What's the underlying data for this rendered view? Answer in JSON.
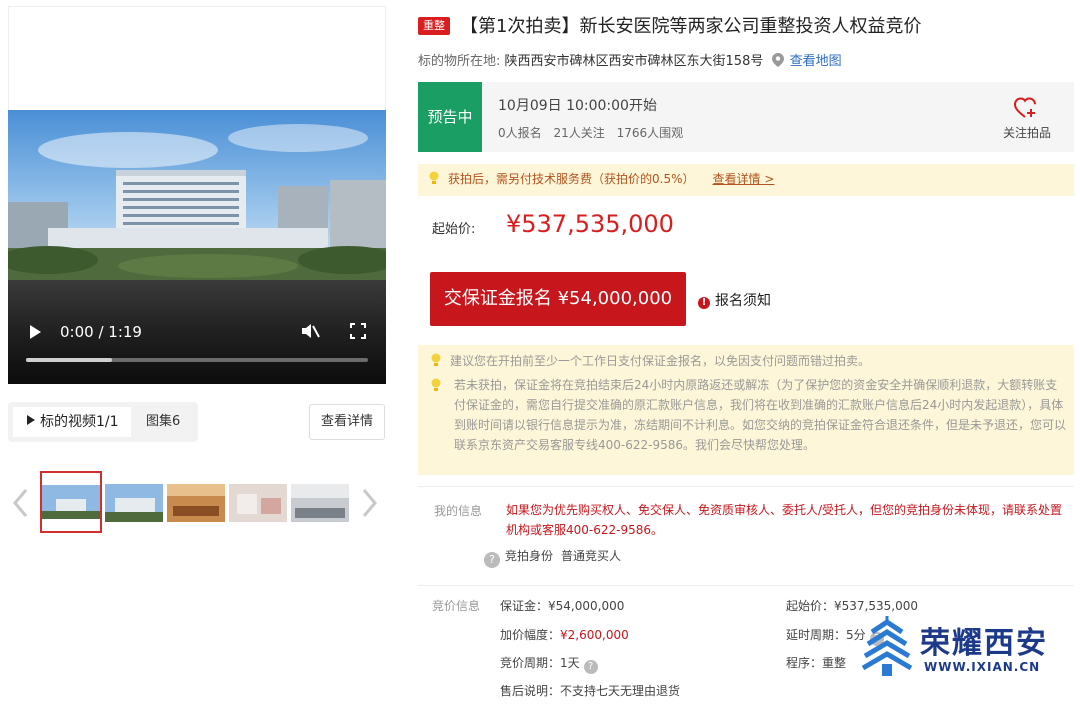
{
  "media": {
    "time_display": "0:00 / 1:19",
    "progress": 0.25,
    "tab_video_label": "标的视频1/1",
    "tab_gallery_label": "图集6",
    "detail_button": "查看详情"
  },
  "thumbnails": [
    "hospital-aerial",
    "hospital-front",
    "interior-hall",
    "ward-room",
    "lobby-seating"
  ],
  "auction": {
    "badge": "重整",
    "title": "【第1次拍卖】新长安医院等两家公司重整投资人权益竞价",
    "location_label": "标的物所在地:",
    "location_address": "陕西西安市碑林区西安市碑林区东大街158号",
    "map_link": "查看地图"
  },
  "status": {
    "tag": "预告中",
    "start_time": "10月09日 10:00:00开始",
    "signups": "0人报名",
    "followers": "21人关注",
    "watchers": "1766人围观",
    "follow_label": "关注拍品"
  },
  "notice": {
    "text": "获拍后，需另付技术服务费（获拍价的0.5%）",
    "link": "查看详情 >"
  },
  "price": {
    "label": "起始价:",
    "value": "¥537,535,000"
  },
  "deposit": {
    "button": "交保证金报名 ¥54,000,000",
    "note": "报名须知"
  },
  "tips": {
    "tip1": "建议您在开拍前至少一个工作日支付保证金报名，以免因支付问题而错过拍卖。",
    "tip2": "若未获拍，保证金将在竞拍结束后24小时内原路返还或解冻（为了保护您的资金安全并确保顺利退款，大额转账支付保证金的，需您自行提交准确的原汇款账户信息，我们将在收到准确的汇款账户信息后24小时内发起退款），具体到账时间请以银行信息提示为准，冻结期间不计利息。如您交纳的竞拍保证金符合退还条件，但是未予退还，您可以联系京东资产交易客服专线400-622-9586。我们会尽快帮您处理。"
  },
  "my_info": {
    "label": "我的信息",
    "warning": "如果您为优先购买权人、免交保人、免资质审核人、委托人/受托人，但您的竞拍身份未体现，请联系处置机构或客服400-622-9586。",
    "role_label": "竞拍身份",
    "role_value": "普通竞买人"
  },
  "bid_info": {
    "label": "竞价信息",
    "deposit": "保证金：¥54,000,000",
    "increment_label": "加价幅度：",
    "increment_value": "¥2,600,000",
    "cycle": "竞价周期：1天",
    "after_sale": "售后说明：不支持七天无理由退货",
    "start_price": "起始价：¥537,535,000",
    "delay": "延时周期：5分",
    "procedure": "程序：重整"
  },
  "watermark": {
    "name": "荣耀西安",
    "url": "WWW.IXIAN.CN"
  },
  "colors": {
    "primary_red": "#c8161d",
    "status_green": "#1a9e63",
    "link_blue": "#2b6cc4",
    "notice_bg": "#fdf6d8"
  }
}
